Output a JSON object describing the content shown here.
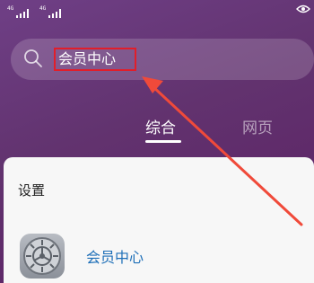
{
  "status_bar": {
    "signal1": "4G",
    "signal2": "4G"
  },
  "search": {
    "value": "会员中心",
    "icon": "search-icon"
  },
  "tabs": [
    {
      "label": "综合",
      "active": true
    },
    {
      "label": "网页",
      "active": false
    }
  ],
  "results": {
    "section_title": "设置",
    "items": [
      {
        "label": "会员中心",
        "icon": "settings-gear-icon"
      }
    ]
  },
  "colors": {
    "highlight_box": "#e11e2a",
    "arrow": "#f04a3a",
    "result_link": "#1e6fb8"
  }
}
